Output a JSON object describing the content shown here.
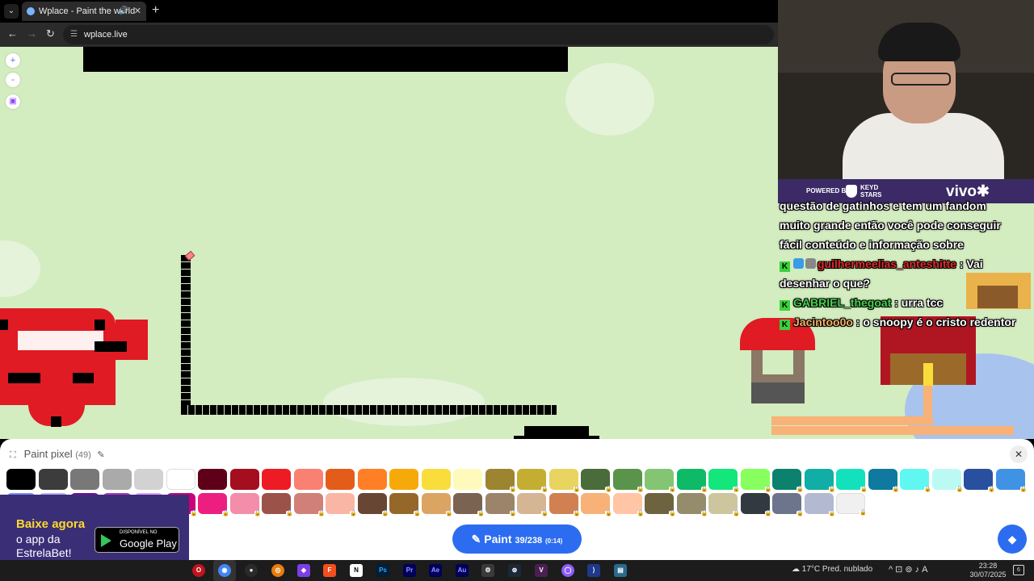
{
  "browser": {
    "tab_title": "Wplace - Paint the world",
    "url": "wplace.live"
  },
  "map_controls": {
    "zoom_in": "+",
    "zoom_out": "-"
  },
  "chat": {
    "lines": [
      "questão de gatinhos e tem um fandom",
      "muito grande então você pode conseguir",
      "fácil conteúdo e informação sobre"
    ],
    "messages": [
      {
        "user": "guilhermeelias_anteshitte",
        "text": " : Vai",
        "cont": "desenhar o que?",
        "color": "#e02a2a"
      },
      {
        "user": "GABRIEL_thegoat",
        "text": " : urra tcc",
        "color": "#45d24d"
      },
      {
        "user": "Jacintoo0o",
        "text": " : o snoopy é o cristo redentor",
        "color": "#f5b06a"
      }
    ]
  },
  "sponsor": {
    "powered_by": "POWERED BY",
    "keyd_line1": "KEYD",
    "keyd_line2": "STARS",
    "vivo": "vivo"
  },
  "paint_panel": {
    "title": "Paint pixel",
    "count": "(49)",
    "paint_label": "Paint",
    "paint_count": "39/238",
    "paint_timer": "(0:14)",
    "palette_row1": [
      "#000000",
      "#3c3c3c",
      "#787878",
      "#aaaaaa",
      "#d2d2d2",
      "#ffffff",
      "#600018",
      "#a50e1e",
      "#ed1c24",
      "#fa8072",
      "#e45c1a",
      "#ff7f27",
      "#f6aa09",
      "#f9dd3b",
      "#fffabc",
      "#9c8431",
      "#c5ad31",
      "#e8d45f",
      "#4a6b3a",
      "#5a944a",
      "#84c573",
      "#0eb968",
      "#13e67b",
      "#87ff5e",
      "#0c816e",
      "#10aea6",
      "#13e1be",
      "#0f799f",
      "#60f7f2",
      "#bbfaf2",
      "#28509e",
      "#4093e4"
    ],
    "palette_row2": [
      "#7d8aff",
      "#b5aef1",
      "#780c99",
      "#aa38b9",
      "#e09ff9",
      "#cb007a",
      "#ec1f80",
      "#f38da9",
      "#9b5249",
      "#d18078",
      "#fab6a4",
      "#684634",
      "#95682a",
      "#dba463",
      "#7b6352",
      "#9c846b",
      "#d6b594",
      "#d18051",
      "#f8b277",
      "#ffc5a5",
      "#6d643f",
      "#948c6b",
      "#cdc59e",
      "#333941",
      "#6d758d",
      "#b3b9d1",
      "#f0f0f0"
    ],
    "locked_row1": [
      15,
      16,
      17,
      18,
      19,
      20,
      21,
      22,
      23,
      24,
      25,
      26,
      27,
      28,
      29,
      30,
      31
    ],
    "locked_row2": [
      0,
      1,
      2,
      3,
      4,
      5,
      6,
      7,
      8,
      9,
      10,
      11,
      12,
      13,
      14,
      15,
      16,
      17,
      18,
      19,
      20,
      21,
      22,
      23,
      24,
      25,
      26
    ]
  },
  "ad": {
    "line1": "Baixe agora",
    "line2": "o app da",
    "line3": "EstrelaBet!",
    "store_small": "DISPONÍVEL NO",
    "store_big": "Google Play"
  },
  "taskbar": {
    "weather_temp": "17°C",
    "weather_desc": "Pred. nublado",
    "time": "23:28",
    "date": "30/07/2025"
  }
}
